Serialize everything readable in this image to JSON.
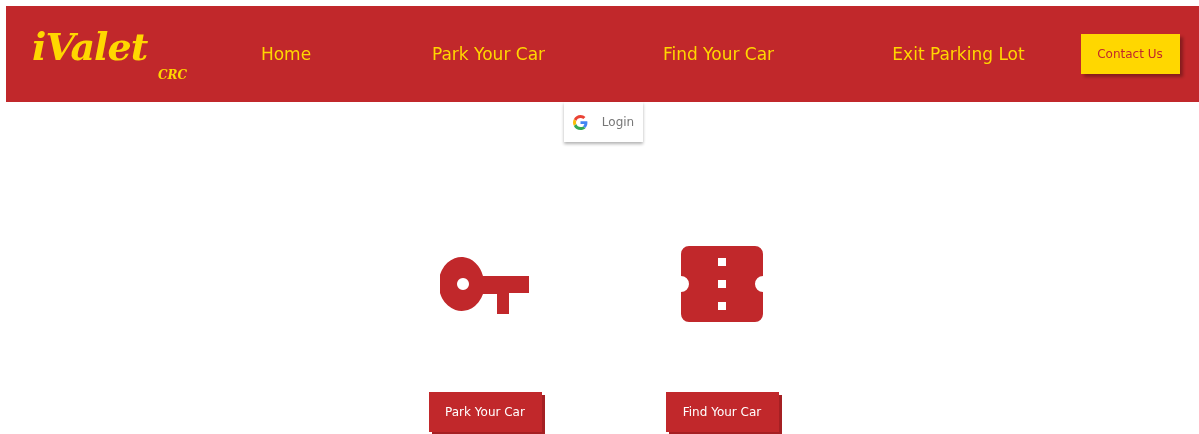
{
  "header": {
    "logo": "iValet",
    "logo_sub": "CRC",
    "nav": [
      {
        "label": "Home"
      },
      {
        "label": "Park Your Car"
      },
      {
        "label": "Find Your Car"
      },
      {
        "label": "Exit Parking Lot"
      }
    ],
    "contact_button": "Contact Us"
  },
  "login_button": "Login",
  "actions": [
    {
      "kind": "key",
      "button": "Park Your Car"
    },
    {
      "kind": "ticket",
      "button": "Find Your Car"
    }
  ]
}
